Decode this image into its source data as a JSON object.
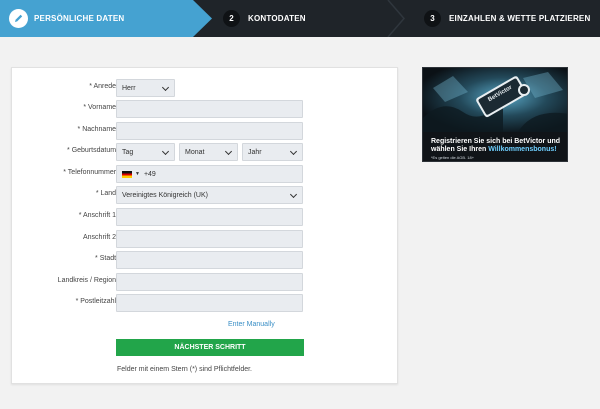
{
  "steps": {
    "step1_label": "PERSÖNLICHE DATEN",
    "step2_num": "2",
    "step2_label": "KONTODATEN",
    "step3_num": "3",
    "step3_label": "EINZAHLEN & WETTE PLATZIEREN"
  },
  "form": {
    "anrede_label": "* Anrede:",
    "anrede_value": "Herr",
    "vorname_label": "* Vorname:",
    "nachname_label": "* Nachname:",
    "geburtsdatum_label": "* Geburtsdatum:",
    "tag_value": "Tag",
    "monat_value": "Monat",
    "jahr_value": "Jahr",
    "telefon_label": "* Telefonnummer:",
    "telefon_prefix": "+49",
    "land_label": "* Land:",
    "land_value": "Vereinigtes Königreich (UK)",
    "anschrift1_label": "* Anschrift 1:",
    "anschrift2_label": "Anschrift 2:",
    "stadt_label": "* Stadt:",
    "region_label": "Landkreis / Region:",
    "postleitzahl_label": "* Postleitzahl:",
    "enter_manually": "Enter Manually",
    "next_button": "NÄCHSTER SCHRITT",
    "required_note": "Felder mit einem Stern (*) sind Pflichtfelder."
  },
  "promo": {
    "line1": "Registrieren Sie sich bei BetVictor und",
    "line2_prefix": "wählen Sie Ihren ",
    "line2_highlight": "Willkommensbonus!",
    "terms": "*Es gelten die AGB. 18+",
    "logo_text": "BetVictor"
  },
  "colors": {
    "step_active": "#45a2d1",
    "step_bar": "#1f2429",
    "button_green": "#22a54a",
    "link_blue": "#3a8fc6",
    "promo_highlight": "#6fd0ff"
  }
}
